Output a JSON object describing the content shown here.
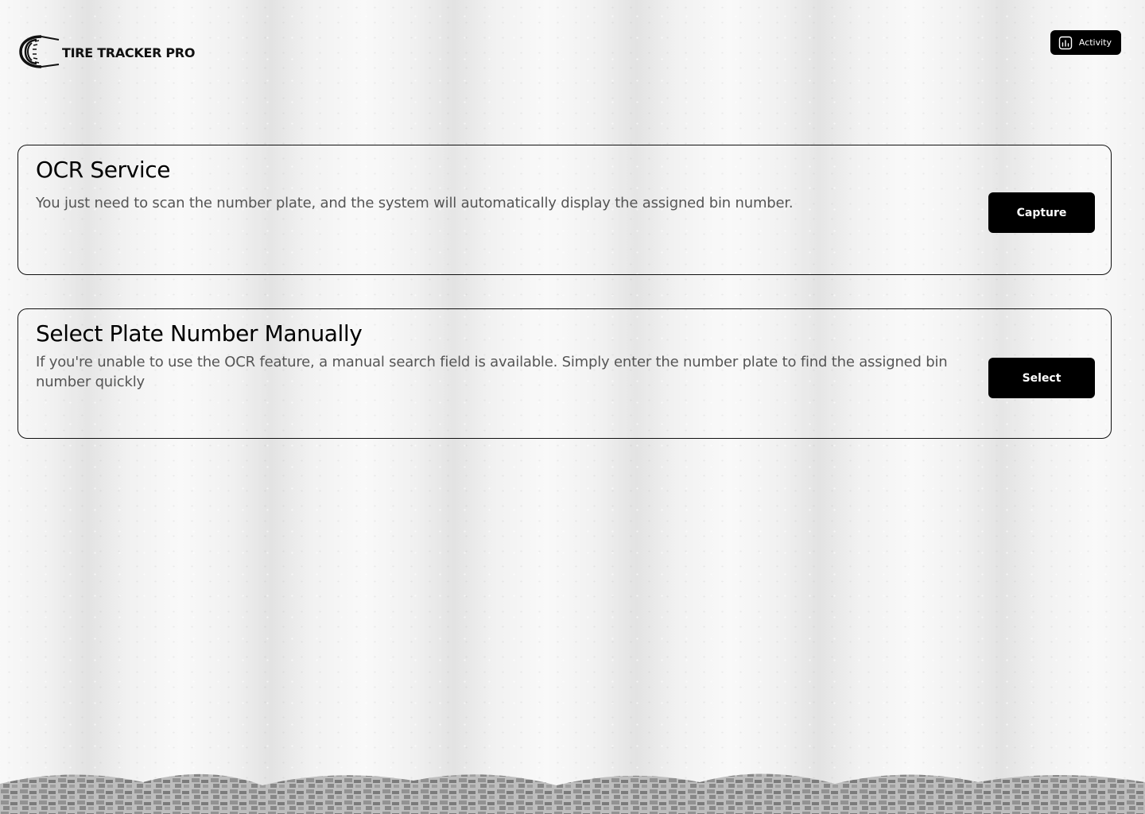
{
  "header": {
    "brand_name": "TIRE TRACKER PRO",
    "logo_icon": "tire-logo-icon",
    "activity_label": "Activity",
    "activity_icon": "activity-chart-icon"
  },
  "cards": {
    "ocr": {
      "title": "OCR Service",
      "description": "You just need to scan the number plate, and the system will automatically display the assigned bin number.",
      "button_label": "Capture"
    },
    "manual": {
      "title": "Select Plate Number Manually",
      "description": "If you're unable to use the OCR feature, a manual search field is available. Simply enter the number plate to find the assigned bin number quickly",
      "button_label": "Select"
    }
  },
  "colors": {
    "primary_button": "#000000",
    "button_text": "#ffffff",
    "title_text": "#000000",
    "body_text": "#555555",
    "card_border": "#111111",
    "background": "#f1f1f1"
  }
}
